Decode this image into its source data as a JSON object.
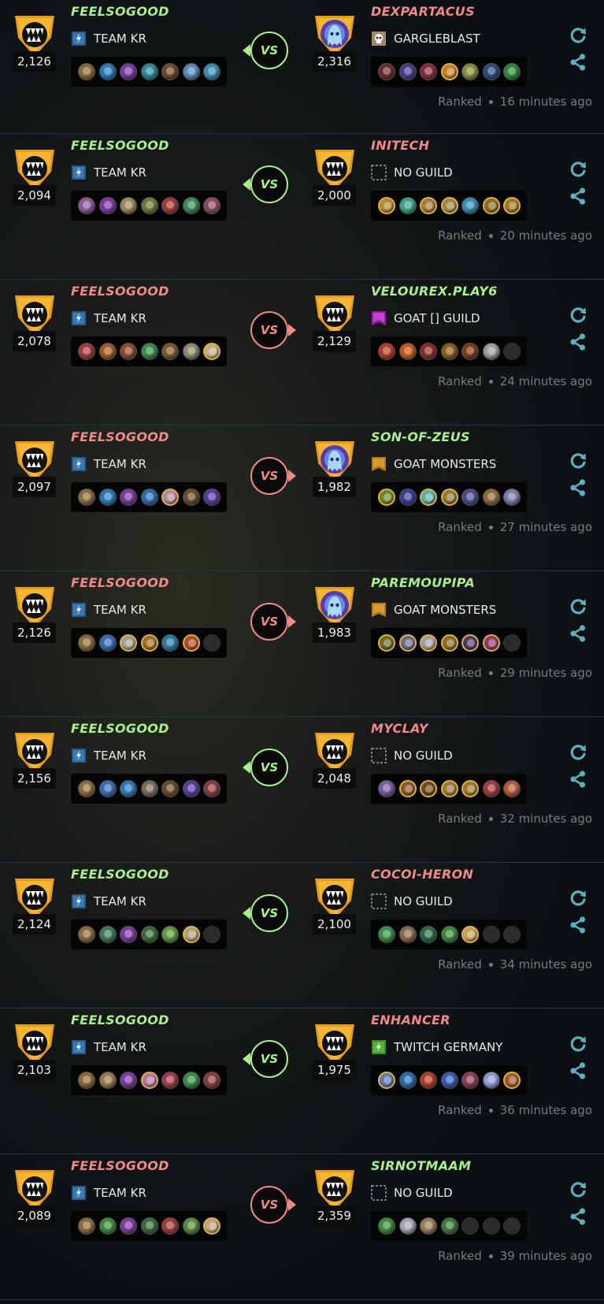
{
  "colors": {
    "win": "#a8f08c",
    "lose": "#f08a8a",
    "accent": "#4a9fb0",
    "border": "#1e3a3f",
    "muted": "#7a7a7a"
  },
  "battles": [
    {
      "left": {
        "name": "FEELSOGOOD",
        "result": "win",
        "rating": "2,126",
        "guild": "TEAM KR",
        "guild_icon": "team-kr-banner",
        "rank_icon": "gold-fanged-badge",
        "cards": [
          {
            "c": "#8a6a3a"
          },
          {
            "c": "#2a7ab8"
          },
          {
            "c": "#7a3aa0"
          },
          {
            "c": "#2a8a9a"
          },
          {
            "c": "#6a4a2a"
          },
          {
            "c": "#5a8ab8"
          },
          {
            "c": "#3a8ab0"
          }
        ]
      },
      "right": {
        "name": "DEXPARTACUS",
        "result": "lose",
        "rating": "2,316",
        "guild": "GARGLEBLAST",
        "guild_icon": "skull-banner",
        "rank_icon": "champion-ghost-badge",
        "cards": [
          {
            "c": "#6a2a2a"
          },
          {
            "c": "#4a3a8a"
          },
          {
            "c": "#8a2a3a"
          },
          {
            "c": "#c0802a",
            "g": 1
          },
          {
            "c": "#8a8a3a"
          },
          {
            "c": "#2a4a7a"
          },
          {
            "c": "#2a8a3a"
          }
        ]
      },
      "mode": "Ranked",
      "time": "16 minutes ago"
    },
    {
      "left": {
        "name": "FEELSOGOOD",
        "result": "win",
        "rating": "2,094",
        "guild": "TEAM KR",
        "guild_icon": "team-kr-banner",
        "rank_icon": "gold-fanged-badge",
        "cards": [
          {
            "c": "#8a5a9a"
          },
          {
            "c": "#7a3aa0"
          },
          {
            "c": "#9a8a5a"
          },
          {
            "c": "#6a7a3a"
          },
          {
            "c": "#a03a3a"
          },
          {
            "c": "#3a8a5a"
          },
          {
            "c": "#8a4a5a"
          }
        ]
      },
      "right": {
        "name": "INITECH",
        "result": "lose",
        "rating": "2,000",
        "guild": "NO GUILD",
        "guild_icon": "no-guild-icon",
        "rank_icon": "gold-fanged-badge",
        "cards": [
          {
            "c": "#b08a3a",
            "g": 1
          },
          {
            "c": "#3aa08a"
          },
          {
            "c": "#a07a3a",
            "g": 1
          },
          {
            "c": "#9a8a4a",
            "g": 1
          },
          {
            "c": "#3a8ab0"
          },
          {
            "c": "#8a6a2a",
            "g": 1
          },
          {
            "c": "#9a7a2a",
            "g": 1
          }
        ]
      },
      "mode": "Ranked",
      "time": "20 minutes ago"
    },
    {
      "left": {
        "name": "FEELSOGOOD",
        "result": "lose",
        "rating": "2,078",
        "guild": "TEAM KR",
        "guild_icon": "team-kr-banner",
        "rank_icon": "gold-fanged-badge",
        "cards": [
          {
            "c": "#a03a3a"
          },
          {
            "c": "#a05a2a"
          },
          {
            "c": "#8a4a2a"
          },
          {
            "c": "#3a8a4a"
          },
          {
            "c": "#7a5a2a"
          },
          {
            "c": "#8a8a6a"
          },
          {
            "c": "#c0b08a",
            "g": 1
          }
        ]
      },
      "right": {
        "name": "VELOUREX.PLAY6",
        "result": "win",
        "rating": "2,129",
        "guild": "GOAT [] GUILD",
        "guild_icon": "purple-banner",
        "rank_icon": "gold-fanged-badge",
        "cards": [
          {
            "c": "#b03a2a"
          },
          {
            "c": "#c05a1a"
          },
          {
            "c": "#8a2a2a"
          },
          {
            "c": "#8a5a1a"
          },
          {
            "c": "#7a3a1a"
          },
          {
            "c": "#9a9aa0"
          },
          {
            "e": 1
          }
        ]
      },
      "mode": "Ranked",
      "time": "24 minutes ago"
    },
    {
      "left": {
        "name": "FEELSOGOOD",
        "result": "lose",
        "rating": "2,097",
        "guild": "TEAM KR",
        "guild_icon": "team-kr-banner",
        "rank_icon": "gold-fanged-badge",
        "cards": [
          {
            "c": "#8a6a3a"
          },
          {
            "c": "#2a7ab8"
          },
          {
            "c": "#7a3aa0"
          },
          {
            "c": "#2a6ab0"
          },
          {
            "c": "#b08aa0",
            "g": 1
          },
          {
            "c": "#6a4a2a"
          },
          {
            "c": "#5a3a9a"
          }
        ]
      },
      "right": {
        "name": "SON-OF-ZEUS",
        "result": "win",
        "rating": "1,982",
        "guild": "GOAT MONSTERS",
        "guild_icon": "gold-banner",
        "rank_icon": "champion-ghost-badge",
        "cards": [
          {
            "c": "#6a8a2a",
            "g": 1
          },
          {
            "c": "#3a3a9a"
          },
          {
            "c": "#5ab0b0",
            "g": 1
          },
          {
            "c": "#8a7a3a",
            "g": 1
          },
          {
            "c": "#4a4a8a"
          },
          {
            "c": "#8a6a3a"
          },
          {
            "c": "#7a7ab0"
          }
        ]
      },
      "mode": "Ranked",
      "time": "27 minutes ago"
    },
    {
      "left": {
        "name": "FEELSOGOOD",
        "result": "lose",
        "rating": "2,126",
        "guild": "TEAM KR",
        "guild_icon": "team-kr-banner",
        "rank_icon": "gold-fanged-badge",
        "cards": [
          {
            "c": "#8a6a3a"
          },
          {
            "c": "#3a6ab0"
          },
          {
            "c": "#a0a090",
            "g": 1
          },
          {
            "c": "#a06a2a",
            "g": 1
          },
          {
            "c": "#2a7aa0"
          },
          {
            "c": "#b04a2a",
            "g": 1
          },
          {
            "e": 1
          }
        ]
      },
      "right": {
        "name": "PAREMOUPIPA",
        "result": "win",
        "rating": "1,983",
        "guild": "GOAT MONSTERS",
        "guild_icon": "gold-banner",
        "rank_icon": "champion-ghost-badge",
        "cards": [
          {
            "c": "#6a6a2a",
            "g": 1
          },
          {
            "c": "#6a6a8a",
            "g": 1
          },
          {
            "c": "#a0a0a0",
            "g": 1
          },
          {
            "c": "#8a6a2a",
            "g": 1
          },
          {
            "c": "#4a3a6a",
            "g": 1
          },
          {
            "c": "#8a3a6a",
            "g": 1
          },
          {
            "e": 1
          }
        ]
      },
      "mode": "Ranked",
      "time": "29 minutes ago"
    },
    {
      "left": {
        "name": "FEELSOGOOD",
        "result": "win",
        "rating": "2,156",
        "guild": "TEAM KR",
        "guild_icon": "team-kr-banner",
        "rank_icon": "gold-fanged-badge",
        "cards": [
          {
            "c": "#8a6a3a"
          },
          {
            "c": "#3a6ab0"
          },
          {
            "c": "#2a7ab8"
          },
          {
            "c": "#7a6a5a"
          },
          {
            "c": "#6a4a2a"
          },
          {
            "c": "#5a3a9a"
          },
          {
            "c": "#8a3a3a"
          }
        ]
      },
      "right": {
        "name": "MYCLAY",
        "result": "lose",
        "rating": "2,048",
        "guild": "NO GUILD",
        "guild_icon": "no-guild-icon",
        "rank_icon": "gold-fanged-badge",
        "cards": [
          {
            "c": "#7a5a9a"
          },
          {
            "c": "#8a5a2a",
            "g": 1
          },
          {
            "c": "#6a4a1a",
            "g": 1
          },
          {
            "c": "#9a7a3a",
            "g": 1
          },
          {
            "c": "#9a7a2a",
            "g": 1
          },
          {
            "c": "#a03a3a"
          },
          {
            "c": "#b05a3a"
          }
        ]
      },
      "mode": "Ranked",
      "time": "32 minutes ago"
    },
    {
      "left": {
        "name": "FEELSOGOOD",
        "result": "win",
        "rating": "2,124",
        "guild": "TEAM KR",
        "guild_icon": "team-kr-banner",
        "rank_icon": "gold-fanged-badge",
        "cards": [
          {
            "c": "#8a6a3a"
          },
          {
            "c": "#3a7a5a"
          },
          {
            "c": "#7a3aa0"
          },
          {
            "c": "#3a6a3a"
          },
          {
            "c": "#5a9a3a"
          },
          {
            "c": "#b0a080",
            "g": 1
          },
          {
            "e": 1
          }
        ]
      },
      "right": {
        "name": "COCOI-HERON",
        "result": "lose",
        "rating": "2,100",
        "guild": "NO GUILD",
        "guild_icon": "no-guild-icon",
        "rank_icon": "gold-fanged-badge",
        "cards": [
          {
            "c": "#3a8a4a"
          },
          {
            "c": "#8a6a4a"
          },
          {
            "c": "#2a6a4a"
          },
          {
            "c": "#3a8a3a"
          },
          {
            "c": "#c0a060",
            "g": 1
          },
          {
            "e": 1
          },
          {
            "e": 1
          }
        ]
      },
      "mode": "Ranked",
      "time": "34 minutes ago"
    },
    {
      "left": {
        "name": "FEELSOGOOD",
        "result": "win",
        "rating": "2,103",
        "guild": "TEAM KR",
        "guild_icon": "team-kr-banner",
        "rank_icon": "gold-fanged-badge",
        "cards": [
          {
            "c": "#8a6a3a"
          },
          {
            "c": "#9a7a4a"
          },
          {
            "c": "#7a3aa0"
          },
          {
            "c": "#b07aa0",
            "g": 1
          },
          {
            "c": "#a03a4a"
          },
          {
            "c": "#3a8a4a"
          },
          {
            "c": "#8a3a3a"
          }
        ]
      },
      "right": {
        "name": "ENHANCER",
        "result": "lose",
        "rating": "1,975",
        "guild": "TWITCH GERMANY",
        "guild_icon": "green-banner",
        "rank_icon": "gold-fanged-badge",
        "cards": [
          {
            "c": "#5a7ab0",
            "g": 1
          },
          {
            "c": "#2a6ab0"
          },
          {
            "c": "#b03a2a"
          },
          {
            "c": "#3a5ab0"
          },
          {
            "c": "#8a3a5a"
          },
          {
            "c": "#8a9ad0"
          },
          {
            "c": "#a05a2a",
            "g": 1
          }
        ]
      },
      "mode": "Ranked",
      "time": "36 minutes ago"
    },
    {
      "left": {
        "name": "FEELSOGOOD",
        "result": "lose",
        "rating": "2,089",
        "guild": "TEAM KR",
        "guild_icon": "team-kr-banner",
        "rank_icon": "gold-fanged-badge",
        "cards": [
          {
            "c": "#8a6a3a"
          },
          {
            "c": "#3a8a3a"
          },
          {
            "c": "#7a3aa0"
          },
          {
            "c": "#3a6a3a"
          },
          {
            "c": "#a03a3a"
          },
          {
            "c": "#5a8a3a"
          },
          {
            "c": "#c0a080",
            "g": 1
          }
        ]
      },
      "right": {
        "name": "SIRNOTMAAM",
        "result": "win",
        "rating": "2,359",
        "guild": "NO GUILD",
        "guild_icon": "no-guild-icon",
        "rank_icon": "gold-fanged-badge",
        "cards": [
          {
            "c": "#3a8a3a"
          },
          {
            "c": "#a0a0b0"
          },
          {
            "c": "#9a7a5a"
          },
          {
            "c": "#3a7a3a"
          },
          {
            "e": 1
          },
          {
            "e": 1
          },
          {
            "e": 1
          }
        ]
      },
      "mode": "Ranked",
      "time": "39 minutes ago"
    }
  ]
}
